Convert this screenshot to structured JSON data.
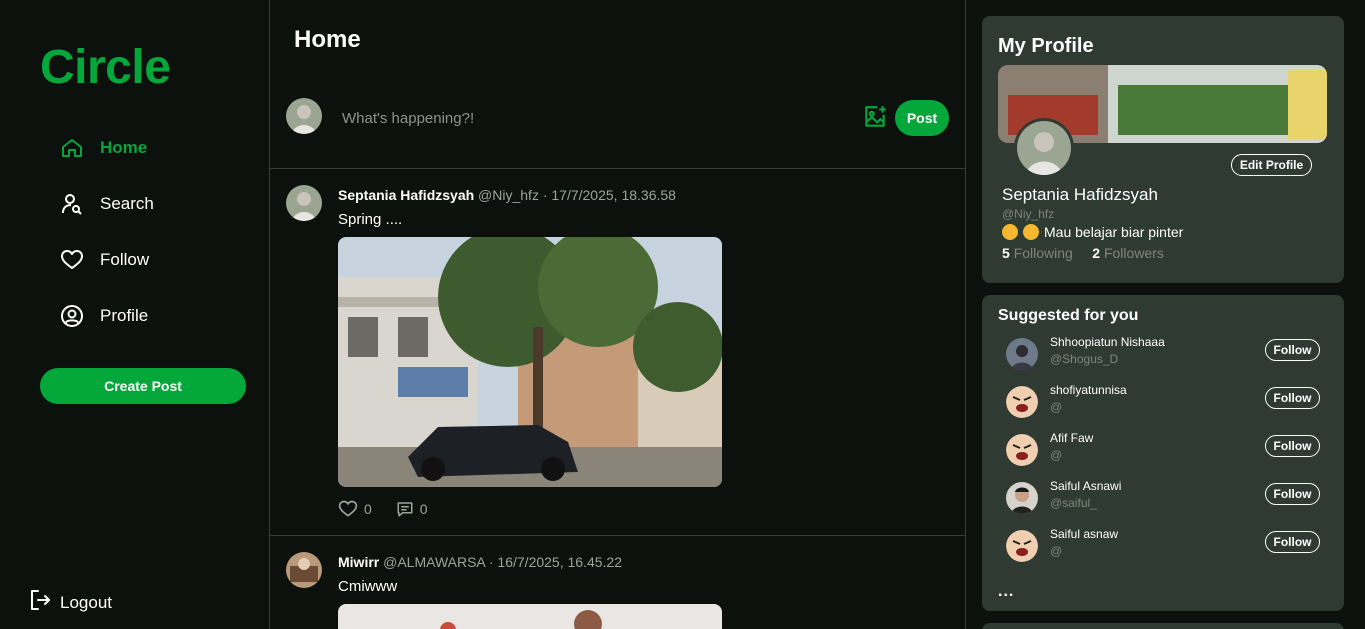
{
  "app": {
    "logo": "Circle"
  },
  "nav": {
    "items": [
      {
        "label": "Home",
        "icon": "home-icon",
        "active": true
      },
      {
        "label": "Search",
        "icon": "search-user-icon"
      },
      {
        "label": "Follow",
        "icon": "heart-icon"
      },
      {
        "label": "Profile",
        "icon": "profile-icon"
      }
    ],
    "create_post": "Create Post",
    "logout": "Logout"
  },
  "main": {
    "title": "Home",
    "composer": {
      "placeholder": "What's happening?!",
      "post_label": "Post"
    },
    "posts": [
      {
        "name": "Septania Hafidzsyah",
        "sub": "@Niy_hfz · 17/7/2025, 18.36.58",
        "text": "Spring ....",
        "likes": "0",
        "comments": "0"
      },
      {
        "name": "Miwirr",
        "sub": "@ALMAWARSA · 16/7/2025, 16.45.22",
        "text": "Cmiwww"
      }
    ]
  },
  "profile": {
    "title": "My Profile",
    "edit_label": "Edit Profile",
    "name": "Septania Hafidzsyah",
    "handle": "@Niy_hfz",
    "bio": "Mau belajar biar pinter",
    "following_count": "5",
    "following_label": "Following",
    "followers_count": "2",
    "followers_label": "Followers"
  },
  "suggested": {
    "title": "Suggested for you",
    "follow_label": "Follow",
    "more": "...",
    "users": [
      {
        "name": "Shhoopiatun Nishaaa",
        "handle": "@Shogus_D"
      },
      {
        "name": "shofiyatunnisa",
        "handle": "@"
      },
      {
        "name": "Afif Faw",
        "handle": "@"
      },
      {
        "name": "Saiful Asnawi",
        "handle": "@saiful_"
      },
      {
        "name": "Saiful asnaw",
        "handle": "@"
      }
    ]
  },
  "colors": {
    "accent": "#04a73a",
    "bg": "#0d110d",
    "card": "#2f3a33",
    "muted": "#7c867c"
  }
}
